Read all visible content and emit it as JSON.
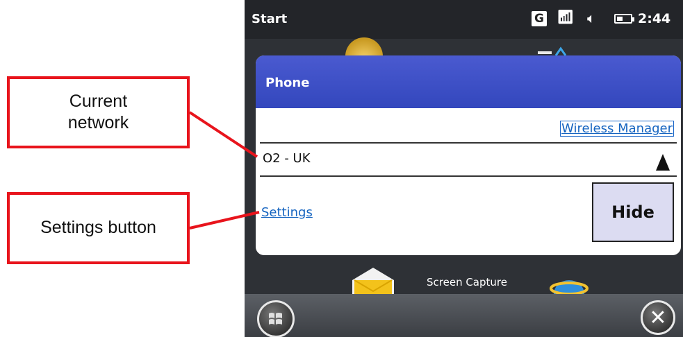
{
  "annotations": {
    "current_network": "Current\nnetwork",
    "settings_button": "Settings button"
  },
  "status_bar": {
    "title": "Start",
    "network_indicator": "G",
    "time": "2:44",
    "icons": [
      "g-network-icon",
      "signal-icon",
      "volume-icon",
      "battery-icon"
    ]
  },
  "dialog": {
    "title": "Phone",
    "wireless_manager_link": "Wireless Manager",
    "network_name": "O2 - UK",
    "settings_link": "Settings",
    "hide_button": "Hide"
  },
  "background": {
    "screen_capture_label": "Screen Capture"
  },
  "colors": {
    "annotation_border": "#e8141c",
    "dialog_header": "#3347bd",
    "link": "#1564c0",
    "hide_button_bg": "#dcdcf2"
  }
}
